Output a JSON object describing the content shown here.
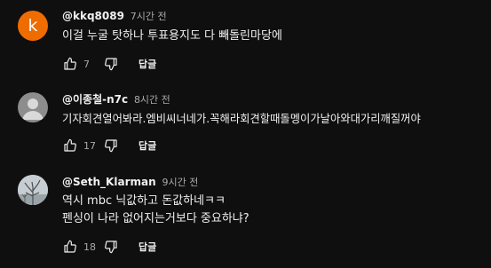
{
  "comments": [
    {
      "avatar_letter": "k",
      "author": "@kkq8089",
      "time": "7시간 전",
      "lines": [
        "이걸 누굴 탓하나 투표용지도 다 빼돌린마당에"
      ],
      "likes": "7",
      "reply_label": "답글"
    },
    {
      "author": "@이종철-n7c",
      "time": "8시간 전",
      "lines": [
        "기자회견열어봐라.엠비씨너네가.꼭해라회견할때돌멩이가날아와대가리깨질꺼야"
      ],
      "likes": "17",
      "reply_label": "답글"
    },
    {
      "author": "@Seth_Klarman",
      "time": "9시간 전",
      "lines": [
        "역시 mbc 닉값하고 돈값하네ㅋㅋ",
        "펜싱이 나라 없어지는거보다 중요하냐?"
      ],
      "likes": "18",
      "reply_label": "답글"
    }
  ],
  "colors": {
    "background": "#0f0f0f",
    "avatar_k": "#ef6c00",
    "secondary_text": "#aaaaaa"
  },
  "icons": [
    "thumb-up-icon",
    "thumb-down-icon"
  ]
}
